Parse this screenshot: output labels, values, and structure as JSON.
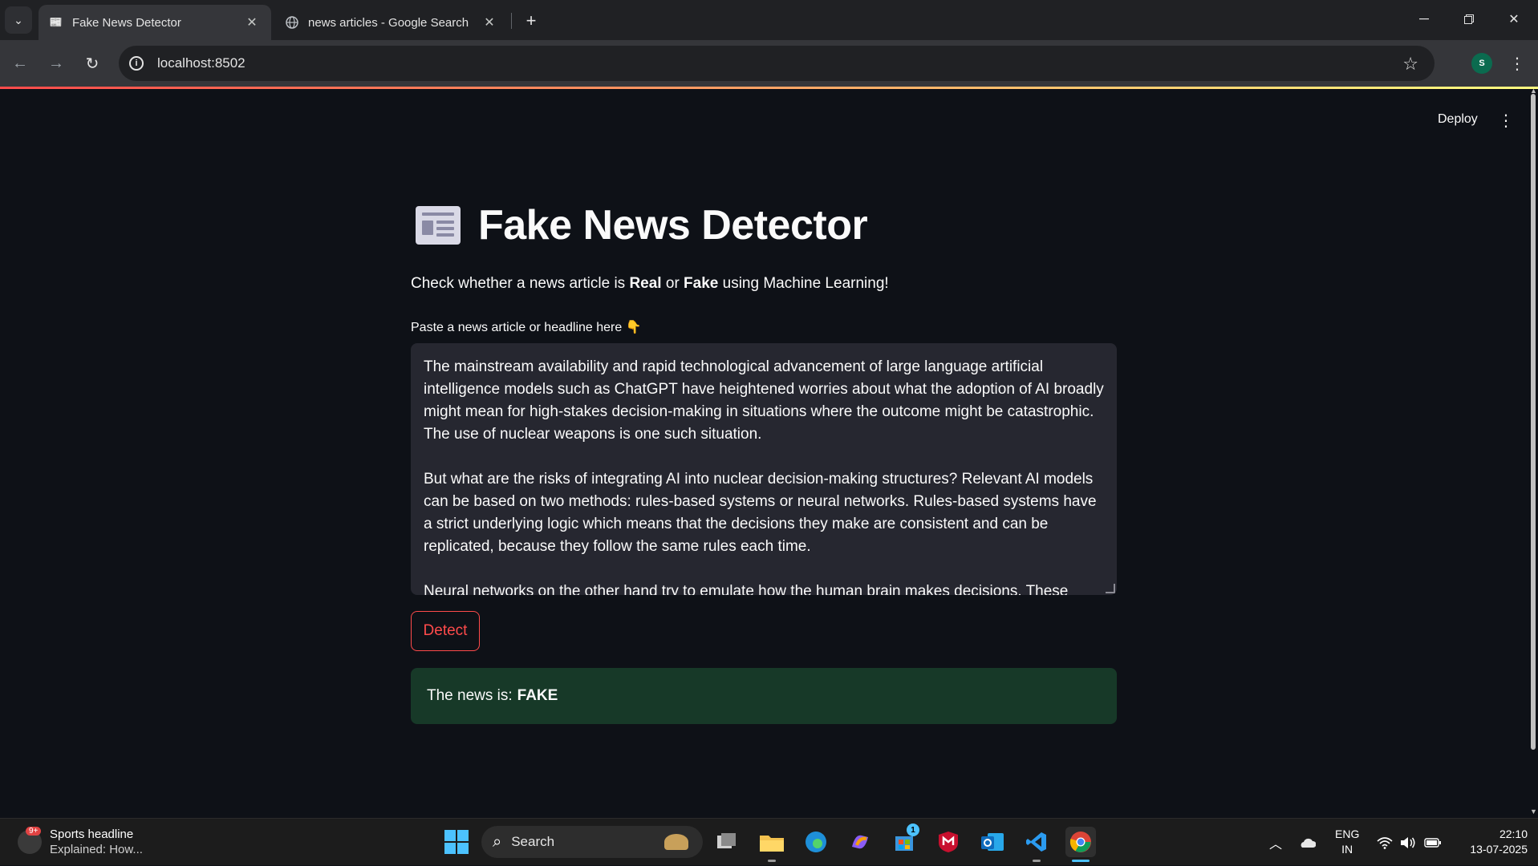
{
  "browser": {
    "tabs": [
      {
        "title": "Fake News Detector",
        "active": true
      },
      {
        "title": "news articles - Google Search",
        "active": false
      }
    ],
    "url": "localhost:8502",
    "profile_initial": "S"
  },
  "app": {
    "header": {
      "deploy_label": "Deploy"
    },
    "title": "Fake News Detector",
    "subtitle": {
      "prefix": "Check whether a news article is ",
      "real": "Real",
      "or": " or ",
      "fake": "Fake",
      "suffix": " using Machine Learning!"
    },
    "input": {
      "label": "Paste a news article or headline here 👇",
      "value": "The mainstream availability and rapid technological advancement of large language artificial intelligence models such as ChatGPT have heightened worries about what the adoption of AI broadly might mean for high-stakes decision-making in situations where the outcome might be catastrophic. The use of nuclear weapons is one such situation.\n\nBut what are the risks of integrating AI into nuclear decision-making structures? Relevant AI models can be based on two methods: rules-based systems or neural networks. Rules-based systems have a strict underlying logic which means that the decisions they make are consistent and can be replicated, because they follow the same rules each time.\n\nNeural networks on the other hand try to emulate how the human brain makes decisions. These"
    },
    "detect_label": "Detect",
    "result": {
      "prefix": "The news is:",
      "value": "FAKE"
    }
  },
  "taskbar": {
    "widget": {
      "badge": "9+",
      "line1": "Sports headline",
      "line2": "Explained: How..."
    },
    "search_label": "Search",
    "store_badge": "1",
    "lang": {
      "line1": "ENG",
      "line2": "IN"
    },
    "clock": {
      "time": "22:10",
      "date": "13-07-2025"
    }
  },
  "colors": {
    "accent": "#ff4b4b",
    "background": "#0e1117",
    "input_bg": "#262730",
    "success_bg": "#173928"
  }
}
